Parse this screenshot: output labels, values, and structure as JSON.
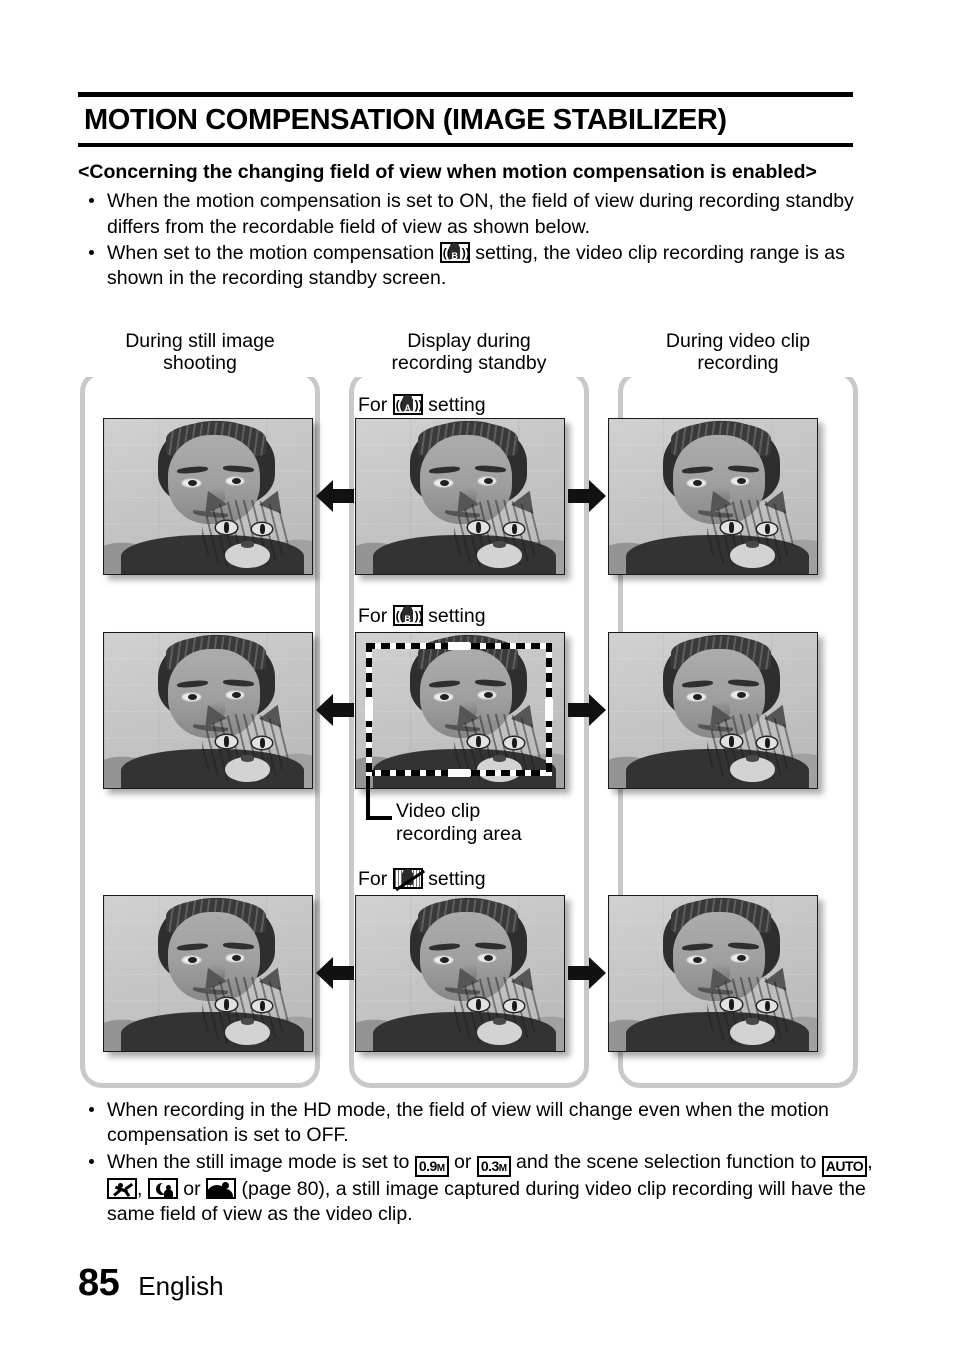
{
  "document": {
    "title": "MOTION COMPENSATION (IMAGE STABILIZER)",
    "subheading": "<Concerning the changing field of view when motion compensation is enabled>"
  },
  "intro_bullets": [
    {
      "text_before": "When the motion compensation is set to ON, the field of view during recording standby differs from the recordable field of view as shown below.",
      "icon": null,
      "text_after": ""
    },
    {
      "text_before": "When set to the motion compensation",
      "icon": "image-stabilizer-b-icon",
      "text_after": "setting, the video clip recording range is as shown in the recording standby screen."
    }
  ],
  "figure": {
    "columns": [
      {
        "caption_line1": "During still image",
        "caption_line2": "shooting"
      },
      {
        "caption_line1": "Display during",
        "caption_line2": "recording standby"
      },
      {
        "caption_line1": "During video clip",
        "caption_line2": "recording"
      }
    ],
    "row_labels": [
      {
        "prefix": "For",
        "icon": "image-stabilizer-a-icon",
        "suffix": "setting"
      },
      {
        "prefix": "For",
        "icon": "image-stabilizer-b-icon",
        "suffix": "setting"
      },
      {
        "prefix": "For",
        "icon": "image-stabilizer-off-icon",
        "suffix": "setting"
      }
    ],
    "callout": {
      "line1": "Video clip",
      "line2": "recording area"
    },
    "arrows": {
      "left": "arrow-left",
      "right": "arrow-right"
    },
    "photo_subject": "grayscale photo of a woman holding a cat"
  },
  "notes": [
    {
      "segments": [
        {
          "type": "text",
          "value": "When recording in the HD mode, the field of view will change even when the motion compensation is set to OFF."
        }
      ]
    },
    {
      "segments": [
        {
          "type": "text",
          "value": "When the still image mode is set to"
        },
        {
          "type": "icon",
          "value": "resolution-0-9m-icon",
          "label": "0.9",
          "sub": "M"
        },
        {
          "type": "text",
          "value": "or"
        },
        {
          "type": "icon",
          "value": "resolution-0-3m-icon",
          "label": "0.3",
          "sub": "M"
        },
        {
          "type": "text",
          "value": "and the scene selection function to"
        },
        {
          "type": "icon",
          "value": "scene-auto-icon",
          "label": "AUTO"
        },
        {
          "type": "text",
          "value": ","
        },
        {
          "type": "icon",
          "value": "scene-sports-icon"
        },
        {
          "type": "text",
          "value": ","
        },
        {
          "type": "icon",
          "value": "scene-night-view-icon"
        },
        {
          "type": "text",
          "value": "or"
        },
        {
          "type": "icon",
          "value": "scene-landscape-icon"
        },
        {
          "type": "text",
          "value": "(page 80), a still image captured during video clip recording will have the same field of view as the video clip."
        }
      ]
    }
  ],
  "note_text": {
    "n1": "When recording in the HD mode, the field of view will change even when the motion compensation is set to OFF.",
    "n2_a": "When the still image mode is set to",
    "n2_or1": "or",
    "n2_b": "and the scene selection function to",
    "n2_comma1": ",",
    "n2_comma2": ",",
    "n2_or2": "or",
    "n2_c": "(page 80), a still image captured during video clip recording will have the same field of view as the video clip.",
    "res09": "0.9",
    "res09_sub": "M",
    "res03": "0.3",
    "res03_sub": "M",
    "auto": "AUTO"
  },
  "bullet_text": {
    "b1": "When the motion compensation is set to ON, the field of view during recording standby differs from the recordable field of view as shown below.",
    "b2_a": "When set to the motion compensation",
    "b2_b": "setting, the video clip recording range is as shown in the recording standby screen."
  },
  "labels": {
    "for": "For",
    "setting": "setting",
    "icon_letter_a": "A",
    "icon_letter_b": "B"
  },
  "footer": {
    "page_number": "85",
    "language": "English"
  },
  "colors": {
    "text": "#000000",
    "rule": "#000000",
    "bracket": "#c9c9c9",
    "page_background": "#ffffff"
  }
}
